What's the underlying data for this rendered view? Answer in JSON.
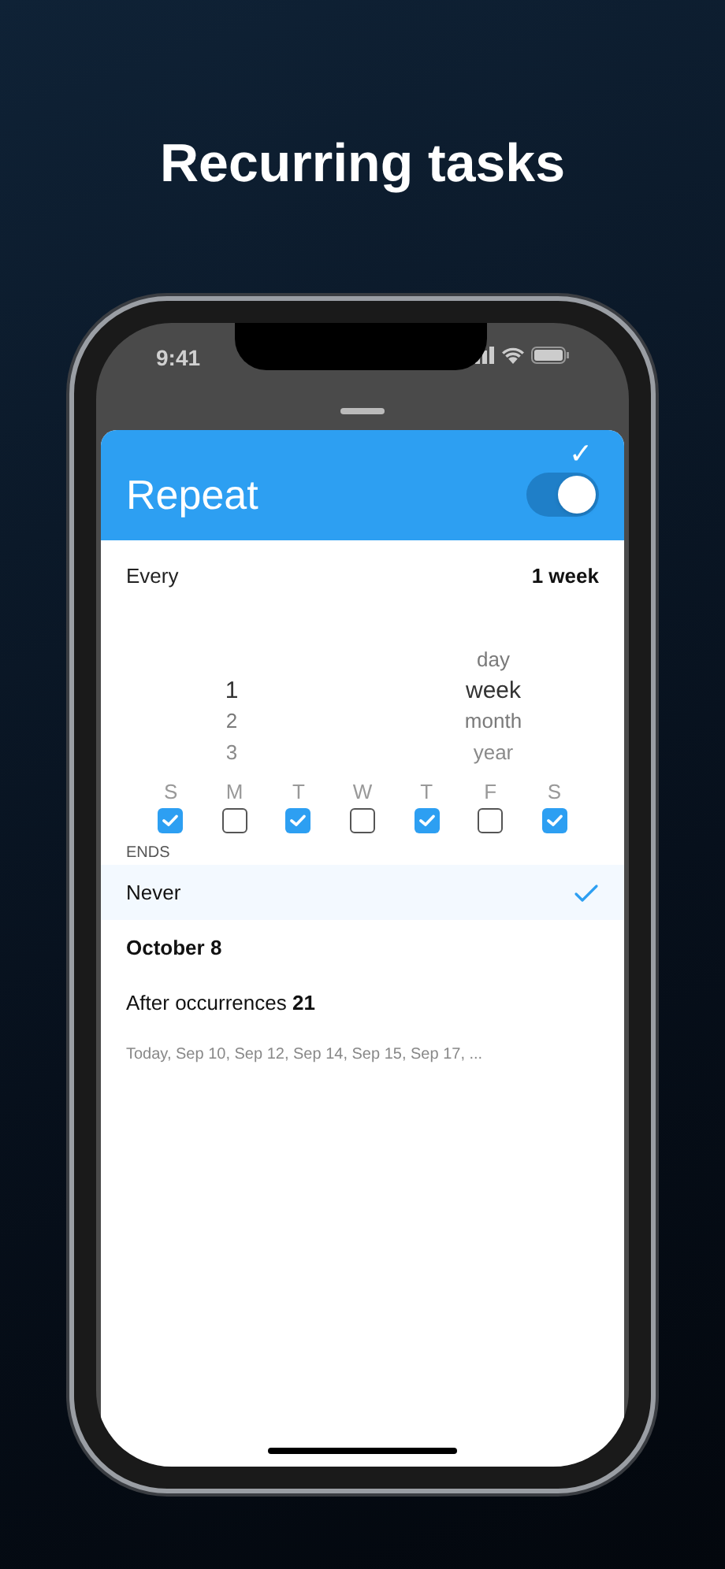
{
  "headline": "Recurring tasks",
  "status_bar": {
    "time": "9:41"
  },
  "sheet": {
    "title": "Repeat",
    "done_icon": "✓",
    "repeat_on": true
  },
  "every": {
    "label": "Every",
    "value": "1 week"
  },
  "picker": {
    "numbers": [
      {
        "label": "1",
        "selected": true
      },
      {
        "label": "2",
        "selected": false
      },
      {
        "label": "3",
        "selected": false
      }
    ],
    "units": [
      {
        "label": "day",
        "selected": false
      },
      {
        "label": "week",
        "selected": true
      },
      {
        "label": "month",
        "selected": false
      },
      {
        "label": "year",
        "selected": false
      }
    ]
  },
  "weekdays": [
    {
      "label": "S",
      "checked": true
    },
    {
      "label": "M",
      "checked": false
    },
    {
      "label": "T",
      "checked": true
    },
    {
      "label": "W",
      "checked": false
    },
    {
      "label": "T",
      "checked": true
    },
    {
      "label": "F",
      "checked": false
    },
    {
      "label": "S",
      "checked": true
    }
  ],
  "ends": {
    "label": "ENDS",
    "options": [
      {
        "label": "Never",
        "selected": true
      },
      {
        "label": "October 8",
        "selected": false
      },
      {
        "label": "After occurrences **21**",
        "selected": false
      }
    ]
  },
  "preview": "Today, Sep 10, Sep 12, Sep 14, Sep 15, Sep 17, ..."
}
